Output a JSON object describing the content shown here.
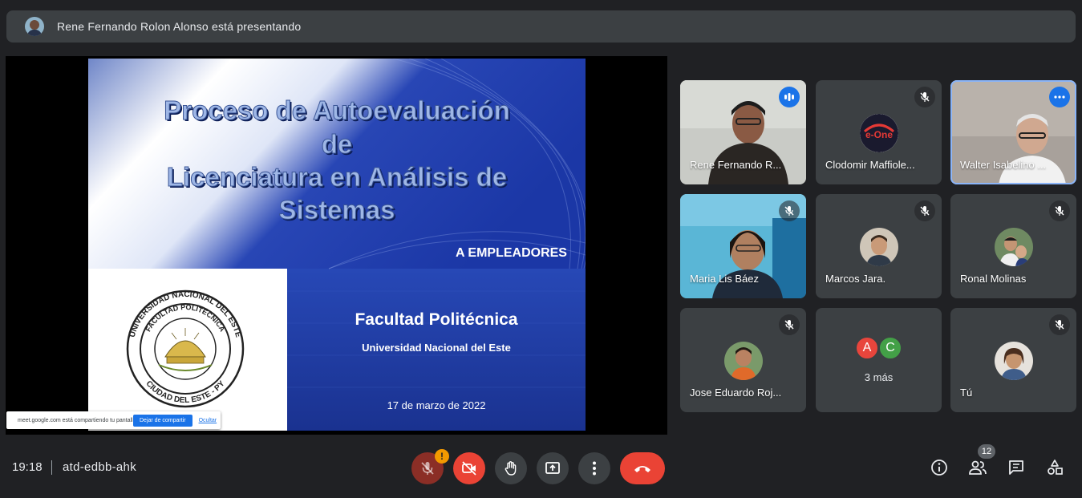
{
  "banner": {
    "presenting_text": "Rene Fernando Rolon Alonso está presentando"
  },
  "slide": {
    "title_lines": [
      "Proceso de Autoevaluación",
      "de",
      "Licenciatura en Análisis de",
      "Sistemas"
    ],
    "subtitle": "A EMPLEADORES",
    "faculty": "Facultad Politécnica",
    "university": "Universidad Nacional del Este",
    "date": "17 de marzo de 2022",
    "seal_text": {
      "outer_top": "UNIVERSIDAD NACIONAL DEL ESTE",
      "outer_bottom": "CIUDAD DEL ESTE - PY",
      "inner": "FACULTAD POLITÉCNICA"
    }
  },
  "share_notice": {
    "message": "meet.google.com está compartiendo tu pantalla.",
    "stop_label": "Dejar de compartir",
    "hide_label": "Ocultar"
  },
  "participants": [
    {
      "name": "Rene Fernando R...",
      "status": "speaking"
    },
    {
      "name": "Clodomir Maffiole...",
      "status": "muted"
    },
    {
      "name": "Walter Isabelino ...",
      "status": "more"
    },
    {
      "name": "Maria Lis Báez",
      "status": "muted"
    },
    {
      "name": "Marcos Jara.",
      "status": "muted"
    },
    {
      "name": "Ronal Molinas",
      "status": "muted"
    },
    {
      "name": "Jose Eduardo Roj...",
      "status": "muted"
    },
    {
      "name": "3 más",
      "status": "group",
      "avatars": [
        "A",
        "C"
      ]
    },
    {
      "name": "Tú",
      "status": "muted"
    }
  ],
  "tile_logo_text": "e-One",
  "controls": {
    "time": "19:18",
    "meeting_code": "atd-edbb-ahk",
    "mic_alert": "!",
    "participant_count": "12"
  },
  "colors": {
    "background": "#202124",
    "tile": "#3c4043",
    "danger": "#ea4335",
    "accent": "#1a73e8",
    "avatar_a": "#e8453c",
    "avatar_c": "#43a047"
  }
}
